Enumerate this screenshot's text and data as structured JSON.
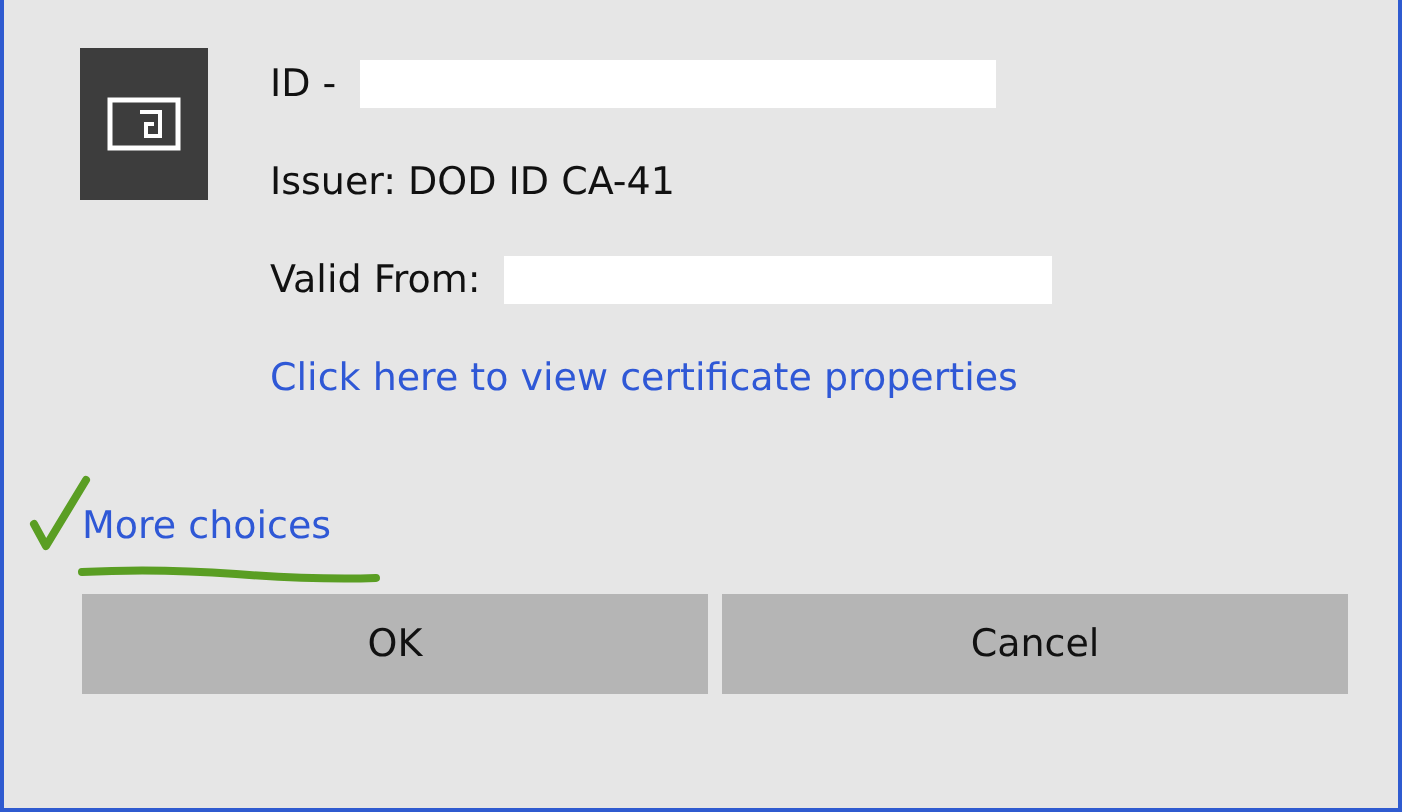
{
  "certificate": {
    "id_label": "ID -",
    "issuer": "Issuer: DOD ID CA-41",
    "valid_from_label": "Valid From:",
    "properties_link": "Click here to view certificate properties"
  },
  "more_choices": "More choices",
  "buttons": [
    {
      "label": "OK"
    },
    {
      "label": "Cancel"
    }
  ]
}
